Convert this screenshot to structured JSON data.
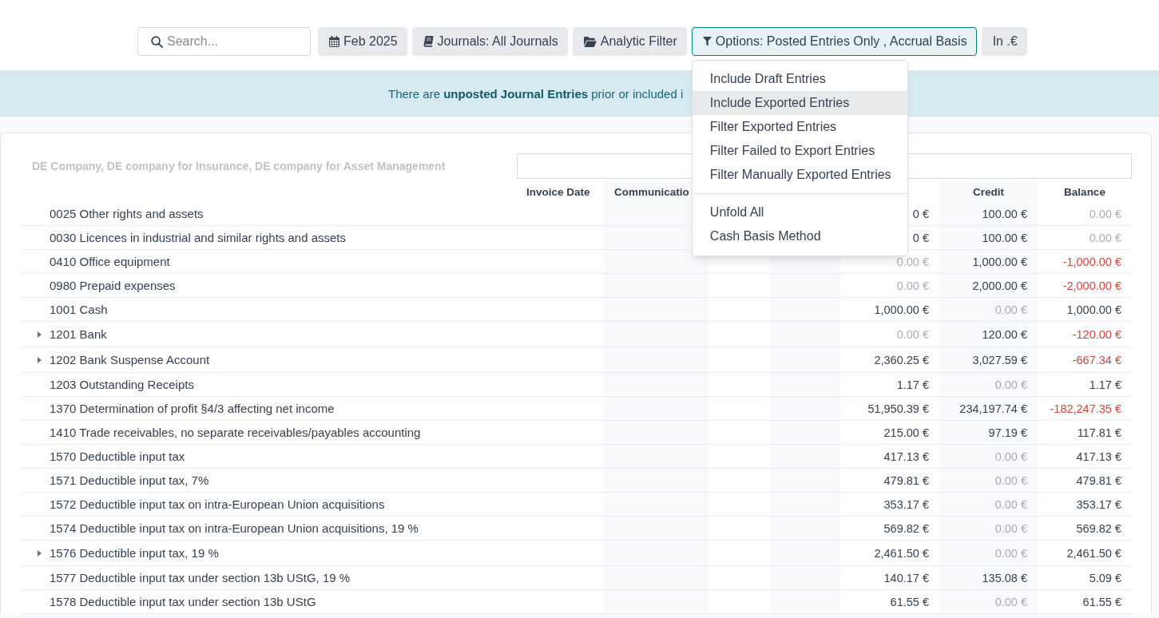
{
  "search": {
    "placeholder": "Search..."
  },
  "filters": [
    {
      "kind": "period",
      "label": "Feb 2025",
      "open": false
    },
    {
      "kind": "journals",
      "label": "Journals: All Journals",
      "open": false
    },
    {
      "kind": "analytic",
      "label": "Analytic Filter",
      "open": false
    },
    {
      "kind": "options",
      "label": "Options: Posted Entries Only , Accrual Basis",
      "open": true
    },
    {
      "kind": "currency",
      "label": "In .€",
      "open": false
    }
  ],
  "options_menu": {
    "sections": [
      {
        "items": [
          {
            "label": "Include Draft Entries",
            "highlighted": false
          },
          {
            "label": "Include Exported Entries",
            "highlighted": true
          },
          {
            "label": "Filter Exported Entries",
            "highlighted": false
          },
          {
            "label": "Filter Failed to Export Entries",
            "highlighted": false
          },
          {
            "label": "Filter Manually Exported Entries",
            "highlighted": false
          }
        ]
      },
      {
        "items": [
          {
            "label": "Unfold All",
            "highlighted": false
          },
          {
            "label": "Cash Basis Method",
            "highlighted": false
          }
        ]
      }
    ]
  },
  "banner": {
    "text": "There are **unposted Journal Entries** prior or included i"
  },
  "report": {
    "companies": "DE Company, DE company for Insurance, DE company for Asset Management",
    "columns": [
      {
        "label": "Invoice Date",
        "shaded": false
      },
      {
        "label": "Communicatio",
        "shaded": true
      },
      {
        "shaded": false
      },
      {
        "shaded": true
      },
      {
        "shaded": false
      },
      {
        "label": "Credit",
        "shaded": true
      },
      {
        "label": "Balance",
        "shaded": false
      }
    ],
    "rows": [
      {
        "account": "0025 Other rights and assets",
        "foldable": false,
        "debit": {
          "text": "0 €",
          "muted": false,
          "negative": false
        },
        "credit": {
          "text": "100.00 €",
          "muted": false,
          "negative": false
        },
        "balance": {
          "text": "0.00 €",
          "muted": true,
          "negative": false
        }
      },
      {
        "account": "0030 Licences in industrial and similar rights and assets",
        "foldable": false,
        "debit": {
          "text": "0 €",
          "muted": false,
          "negative": false
        },
        "credit": {
          "text": "100.00 €",
          "muted": false,
          "negative": false
        },
        "balance": {
          "text": "0.00 €",
          "muted": true,
          "negative": false
        }
      },
      {
        "account": "0410 Office equipment",
        "foldable": false,
        "debit": {
          "text": "0.00 €",
          "muted": true,
          "negative": false
        },
        "credit": {
          "text": "1,000.00 €",
          "muted": false,
          "negative": false
        },
        "balance": {
          "text": "-1,000.00 €",
          "muted": false,
          "negative": true
        }
      },
      {
        "account": "0980 Prepaid expenses",
        "foldable": false,
        "debit": {
          "text": "0.00 €",
          "muted": true,
          "negative": false
        },
        "credit": {
          "text": "2,000.00 €",
          "muted": false,
          "negative": false
        },
        "balance": {
          "text": "-2,000.00 €",
          "muted": false,
          "negative": true
        }
      },
      {
        "account": "1001 Cash",
        "foldable": false,
        "debit": {
          "text": "1,000.00 €",
          "muted": false,
          "negative": false
        },
        "credit": {
          "text": "0.00 €",
          "muted": true,
          "negative": false
        },
        "balance": {
          "text": "1,000.00 €",
          "muted": false,
          "negative": false
        }
      },
      {
        "account": "1201 Bank",
        "foldable": true,
        "debit": {
          "text": "0.00 €",
          "muted": true,
          "negative": false
        },
        "credit": {
          "text": "120.00 €",
          "muted": false,
          "negative": false
        },
        "balance": {
          "text": "-120.00 €",
          "muted": false,
          "negative": true
        }
      },
      {
        "account": "1202 Bank Suspense Account",
        "foldable": true,
        "debit": {
          "text": "2,360.25 €",
          "muted": false,
          "negative": false
        },
        "credit": {
          "text": "3,027.59 €",
          "muted": false,
          "negative": false
        },
        "balance": {
          "text": "-667.34 €",
          "muted": false,
          "negative": true
        }
      },
      {
        "account": "1203 Outstanding Receipts",
        "foldable": false,
        "debit": {
          "text": "1.17 €",
          "muted": false,
          "negative": false
        },
        "credit": {
          "text": "0.00 €",
          "muted": true,
          "negative": false
        },
        "balance": {
          "text": "1.17 €",
          "muted": false,
          "negative": false
        }
      },
      {
        "account": "1370 Determination of profit §4/3 affecting net income",
        "foldable": false,
        "debit": {
          "text": "51,950.39 €",
          "muted": false,
          "negative": false
        },
        "credit": {
          "text": "234,197.74 €",
          "muted": false,
          "negative": false
        },
        "balance": {
          "text": "-182,247.35 €",
          "muted": false,
          "negative": true
        }
      },
      {
        "account": "1410 Trade receivables, no separate receivables/payables accounting",
        "foldable": false,
        "debit": {
          "text": "215.00 €",
          "muted": false,
          "negative": false
        },
        "credit": {
          "text": "97.19 €",
          "muted": false,
          "negative": false
        },
        "balance": {
          "text": "117.81 €",
          "muted": false,
          "negative": false
        }
      },
      {
        "account": "1570 Deductible input tax",
        "foldable": false,
        "debit": {
          "text": "417.13 €",
          "muted": false,
          "negative": false
        },
        "credit": {
          "text": "0.00 €",
          "muted": true,
          "negative": false
        },
        "balance": {
          "text": "417.13 €",
          "muted": false,
          "negative": false
        }
      },
      {
        "account": "1571 Deductible input tax, 7%",
        "foldable": false,
        "debit": {
          "text": "479.81 €",
          "muted": false,
          "negative": false
        },
        "credit": {
          "text": "0.00 €",
          "muted": true,
          "negative": false
        },
        "balance": {
          "text": "479.81 €",
          "muted": false,
          "negative": false
        }
      },
      {
        "account": "1572 Deductible input tax on intra-European Union acquisitions",
        "foldable": false,
        "debit": {
          "text": "353.17 €",
          "muted": false,
          "negative": false
        },
        "credit": {
          "text": "0.00 €",
          "muted": true,
          "negative": false
        },
        "balance": {
          "text": "353.17 €",
          "muted": false,
          "negative": false
        }
      },
      {
        "account": "1574 Deductible input tax on intra-European Union acquisitions, 19 %",
        "foldable": false,
        "debit": {
          "text": "569.82 €",
          "muted": false,
          "negative": false
        },
        "credit": {
          "text": "0.00 €",
          "muted": true,
          "negative": false
        },
        "balance": {
          "text": "569.82 €",
          "muted": false,
          "negative": false
        }
      },
      {
        "account": "1576 Deductible input tax, 19 %",
        "foldable": true,
        "debit": {
          "text": "2,461.50 €",
          "muted": false,
          "negative": false
        },
        "credit": {
          "text": "0.00 €",
          "muted": true,
          "negative": false
        },
        "balance": {
          "text": "2,461.50 €",
          "muted": false,
          "negative": false
        }
      },
      {
        "account": "1577 Deductible input tax under section 13b UStG, 19 %",
        "foldable": false,
        "debit": {
          "text": "140.17 €",
          "muted": false,
          "negative": false
        },
        "credit": {
          "text": "135.08 €",
          "muted": false,
          "negative": false
        },
        "balance": {
          "text": "5.09 €",
          "muted": false,
          "negative": false
        }
      },
      {
        "account": "1578 Deductible input tax under section 13b UStG",
        "foldable": false,
        "debit": {
          "text": "61.55 €",
          "muted": false,
          "negative": false
        },
        "credit": {
          "text": "0.00 €",
          "muted": true,
          "negative": false
        },
        "balance": {
          "text": "61.55 €",
          "muted": false,
          "negative": false
        }
      }
    ]
  }
}
